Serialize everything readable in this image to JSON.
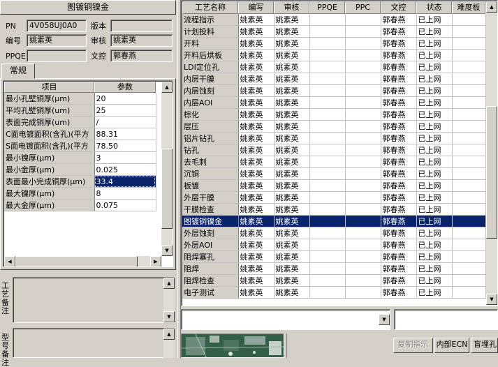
{
  "left_panel": {
    "title": "图镀铜镍金",
    "info": {
      "pn_label": "PN",
      "pn_value": "4V058UJ0A0",
      "version_label": "版本",
      "version_value": "",
      "writer_label": "编号",
      "writer_value": "姚素英",
      "reviewer_label": "审核",
      "reviewer_value": "姚素英",
      "ppqe_label": "PPQE",
      "ppqe_value": "",
      "doc_label": "文控",
      "doc_value": "郭春燕"
    },
    "tab_label": "常规",
    "params": {
      "col_item": "项目",
      "col_param": "参数",
      "rows": [
        {
          "item": "最小孔壁铜厚(μm)",
          "value": "20"
        },
        {
          "item": "平均孔壁铜厚(um)",
          "value": "25"
        },
        {
          "item": "表面完成铜厚(um)",
          "value": "/"
        },
        {
          "item": "C面电镀面积(含孔)(平方",
          "value": "88.31"
        },
        {
          "item": "S面电镀面积(含孔)(平方",
          "value": "78.50"
        },
        {
          "item": "最小镍厚(μm)",
          "value": "3"
        },
        {
          "item": "最小金厚(μm)",
          "value": "0.025"
        },
        {
          "item": "表面最小完成铜厚(μm)",
          "value": "33.4"
        },
        {
          "item": "最大镍厚(μm)",
          "value": "8"
        },
        {
          "item": "最大金厚(μm)",
          "value": "0.075"
        }
      ],
      "selected_index": 7
    },
    "notes_label": "工艺备注",
    "model_label": "型号备注"
  },
  "workflow": {
    "columns": [
      "工艺名称",
      "编写",
      "审核",
      "PPQE",
      "PPC",
      "文控",
      "状态",
      "难度板"
    ],
    "rows": [
      [
        "流程指示",
        "姚素英",
        "姚素英",
        "",
        "",
        "郭春燕",
        "已上网",
        ""
      ],
      [
        "计划投料",
        "姚素英",
        "姚素英",
        "",
        "",
        "郭春燕",
        "已上网",
        ""
      ],
      [
        "开料",
        "姚素英",
        "姚素英",
        "",
        "",
        "郭春燕",
        "已上网",
        ""
      ],
      [
        "开料后烘板",
        "姚素英",
        "姚素英",
        "",
        "",
        "郭春燕",
        "已上网",
        ""
      ],
      [
        "LDI定位孔",
        "姚素英",
        "姚素英",
        "",
        "",
        "郭春燕",
        "已上网",
        ""
      ],
      [
        "内层干膜",
        "姚素英",
        "姚素英",
        "",
        "",
        "郭春燕",
        "已上网",
        ""
      ],
      [
        "内层蚀刻",
        "姚素英",
        "姚素英",
        "",
        "",
        "郭春燕",
        "已上网",
        ""
      ],
      [
        "内层AOI",
        "姚素英",
        "姚素英",
        "",
        "",
        "郭春燕",
        "已上网",
        ""
      ],
      [
        "棕化",
        "姚素英",
        "姚素英",
        "",
        "",
        "郭春燕",
        "已上网",
        ""
      ],
      [
        "层压",
        "姚素英",
        "姚素英",
        "",
        "",
        "郭春燕",
        "已上网",
        ""
      ],
      [
        "铝片钻孔",
        "姚素英",
        "姚素英",
        "",
        "",
        "郭春燕",
        "已上网",
        ""
      ],
      [
        "钻孔",
        "姚素英",
        "姚素英",
        "",
        "",
        "郭春燕",
        "已上网",
        ""
      ],
      [
        "去毛刺",
        "姚素英",
        "姚素英",
        "",
        "",
        "郭春燕",
        "已上网",
        ""
      ],
      [
        "沉铜",
        "姚素英",
        "姚素英",
        "",
        "",
        "郭春燕",
        "已上网",
        ""
      ],
      [
        "板镀",
        "姚素英",
        "姚素英",
        "",
        "",
        "郭春燕",
        "已上网",
        ""
      ],
      [
        "外层干膜",
        "姚素英",
        "姚素英",
        "",
        "",
        "郭春燕",
        "已上网",
        ""
      ],
      [
        "干膜检查",
        "姚素英",
        "姚素英",
        "",
        "",
        "郭春燕",
        "已上网",
        ""
      ],
      [
        "图镀铜镍金",
        "姚素英",
        "姚素英",
        "",
        "",
        "郭春燕",
        "已上网",
        ""
      ],
      [
        "外层蚀刻",
        "姚素英",
        "姚素英",
        "",
        "",
        "郭春燕",
        "已上网",
        ""
      ],
      [
        "外层AOI",
        "姚素英",
        "姚素英",
        "",
        "",
        "郭春燕",
        "已上网",
        ""
      ],
      [
        "阻焊塞孔",
        "姚素英",
        "姚素英",
        "",
        "",
        "郭春燕",
        "已上网",
        ""
      ],
      [
        "阻焊",
        "姚素英",
        "姚素英",
        "",
        "",
        "郭春燕",
        "已上网",
        ""
      ],
      [
        "阻焊检查",
        "姚素英",
        "姚素英",
        "",
        "",
        "郭春燕",
        "已上网",
        ""
      ],
      [
        "电子测试",
        "姚素英",
        "姚素英",
        "",
        "",
        "郭春燕",
        "已上网",
        ""
      ]
    ],
    "selected_index": 17
  },
  "bottom": {
    "combo_value": "",
    "buttons": {
      "copy": "复制指示",
      "ecn": "内部ECN",
      "buried": "盲埋孔"
    }
  },
  "colors": {
    "selection": "#0a246a",
    "face": "#d4d0c8"
  }
}
